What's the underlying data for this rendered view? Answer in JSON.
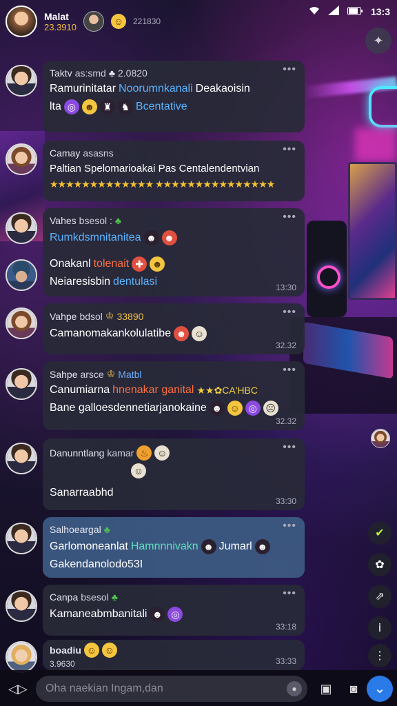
{
  "status": {
    "time": "13:3",
    "wifi_icon": "wifi-icon",
    "signal_icon": "signal-icon",
    "battery_icon": "battery-icon"
  },
  "header": {
    "name": "Malat",
    "sub": "23.3910",
    "count": "221830"
  },
  "messages": [
    {
      "author": "Taktv",
      "meta": "as:smd",
      "meta2": "2.0820",
      "line1": "Ramurinitatar",
      "line1b": "Noorumnkanali",
      "line1c": "Deakaoisin",
      "line2a": "lta",
      "line2b": "Bcentative"
    },
    {
      "author": "Camay",
      "meta": "asasns",
      "line1": "Paltian Spelomarioakai Pas Centalendentvian",
      "stars": "★★★★★★★★★★★★★ ★★★★★★★★★★★★★★★"
    },
    {
      "author": "Vahes",
      "meta": "bsesol :",
      "line1": "Rumkdsmnitanitea",
      "line2a": "Onakanl",
      "line2b": "tolenait",
      "line3a": "Neiaresisbin",
      "line3b": "dentulasi",
      "time": "13:30"
    },
    {
      "author": "Vahpe",
      "meta": "bdsol",
      "meta2": "33890",
      "line1": "Camanomakankolulatibe",
      "time": "32.32"
    },
    {
      "author": "Sahpe",
      "meta": "arsce",
      "meta2": "Matbl",
      "line1a": "Canumiarna",
      "line1b": "hnenakar ganital",
      "line1c": "★★✿CA'HBC",
      "line2": "Bane galloesdennetiarjanokaine",
      "time": "32.32"
    },
    {
      "author": "Danunntlang",
      "meta": "kamar",
      "line1": "Sanarraabhd",
      "time": "33:30"
    },
    {
      "author": "Salhoeargal",
      "line1a": "Garlomoneanlat",
      "line1b": "Hamnnnivakn",
      "line1c": "Jumarl",
      "line2": "Gakendanolodo53I"
    },
    {
      "author": "Canpa",
      "meta": "bsesol",
      "line1": "Kamaneabmbanitali",
      "time": "33:18"
    },
    {
      "author": "boadiu",
      "meta": "3.9630",
      "time": "33:33"
    }
  ],
  "input": {
    "placeholder": "Oha naekian Ingam,dan"
  },
  "colors": {
    "accent": "#2a7ae8",
    "bubble": "#282a38",
    "highlight": "#3c5a82",
    "star": "#f2c232"
  }
}
